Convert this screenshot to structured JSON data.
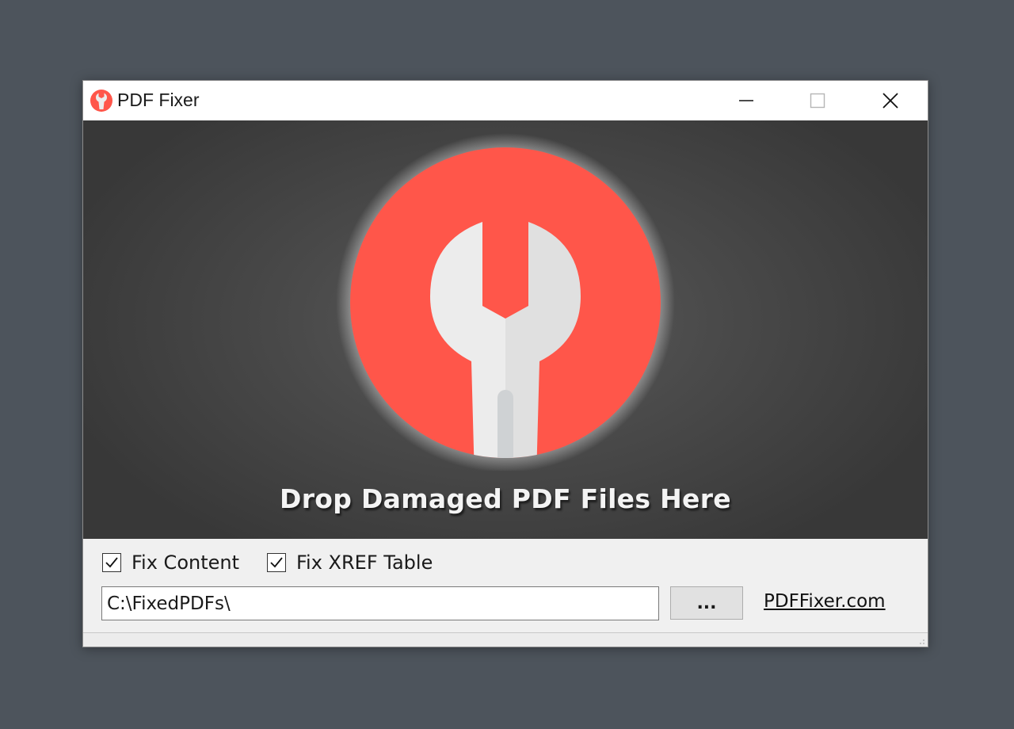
{
  "window": {
    "title": "PDF Fixer",
    "app_icon": "wrench-logo-icon",
    "controls": [
      "minimize-icon",
      "maximize-icon",
      "close-icon"
    ]
  },
  "dropzone": {
    "label": "Drop Damaged PDF Files Here",
    "logo_icon": "wrench-logo-icon",
    "colors": {
      "logo_red": "#ff564a",
      "wrench": "#ececec",
      "background": "#404040"
    }
  },
  "options": {
    "fix_content": {
      "label": "Fix Content",
      "checked": true
    },
    "fix_xref": {
      "label": "Fix XREF Table",
      "checked": true
    }
  },
  "output": {
    "path_value": "C:\\FixedPDFs\\",
    "browse_label": "..."
  },
  "link": {
    "label": "PDFFixer.com"
  }
}
